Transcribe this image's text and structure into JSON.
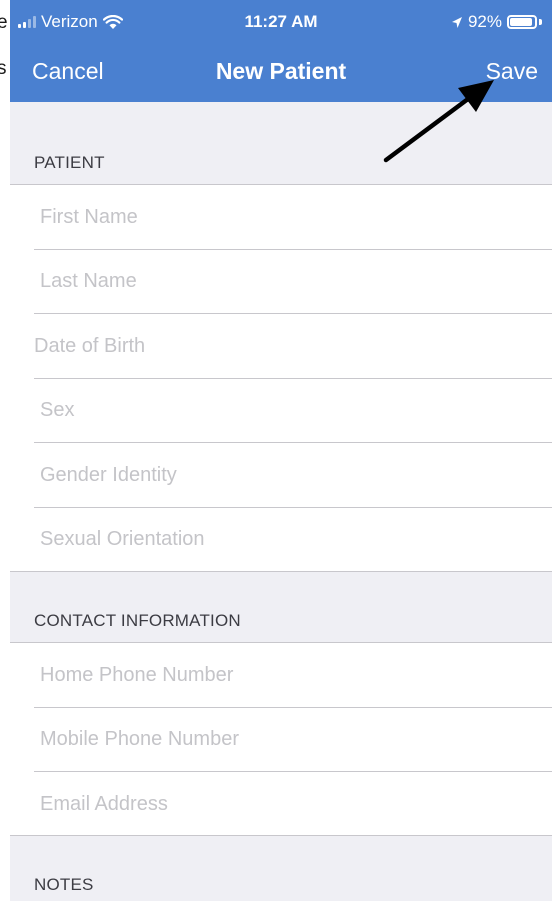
{
  "left_clip": {
    "line1": "e",
    "line2": "s"
  },
  "status_bar": {
    "carrier": "Verizon",
    "time": "11:27 AM",
    "battery": "92%",
    "battery_level": 0.92
  },
  "nav": {
    "cancel_label": "Cancel",
    "title": "New Patient",
    "save_label": "Save"
  },
  "sections": {
    "patient": {
      "header": "PATIENT",
      "fields": [
        "First Name",
        "Last Name",
        "Date of Birth",
        "Sex",
        "Gender Identity",
        "Sexual Orientation"
      ]
    },
    "contact": {
      "header": "CONTACT INFORMATION",
      "fields": [
        "Home Phone Number",
        "Mobile Phone Number",
        "Email Address"
      ]
    },
    "notes": {
      "header": "NOTES"
    }
  },
  "colors": {
    "nav_background": "#4a80d0",
    "page_background": "#efeff4",
    "placeholder": "#c4c4c8"
  }
}
